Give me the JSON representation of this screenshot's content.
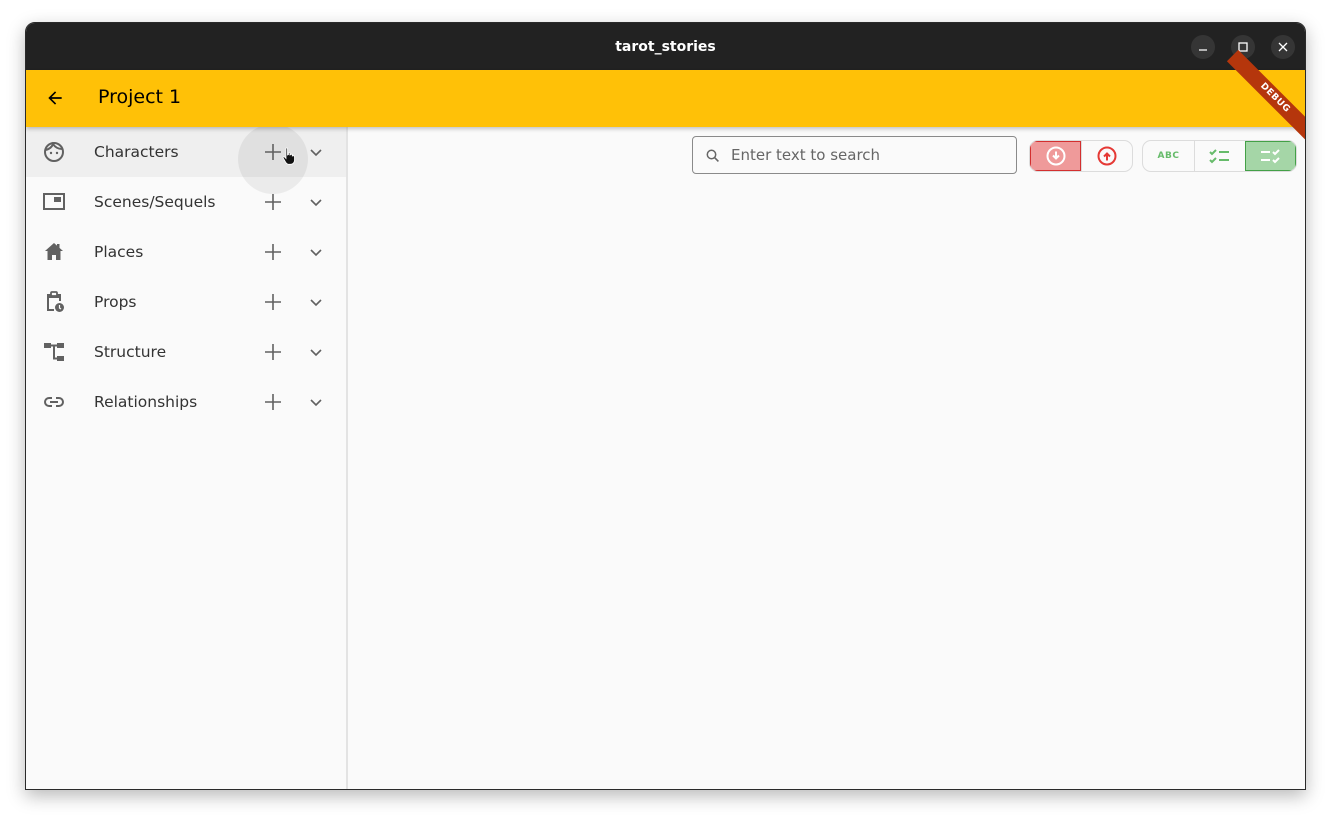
{
  "window": {
    "title": "tarot_stories",
    "controls": [
      "minimize",
      "maximize",
      "close"
    ]
  },
  "appbar": {
    "title": "Project 1",
    "back_icon": "arrow-back-icon",
    "debug_banner": "DEBUG",
    "color": "#ffc107"
  },
  "sidebar": {
    "items": [
      {
        "label": "Characters",
        "icon": "face-icon",
        "hovered": true
      },
      {
        "label": "Scenes/Sequels",
        "icon": "picture-in-picture-icon"
      },
      {
        "label": "Places",
        "icon": "home-icon"
      },
      {
        "label": "Props",
        "icon": "clipboard-clock-icon"
      },
      {
        "label": "Structure",
        "icon": "account-tree-icon"
      },
      {
        "label": "Relationships",
        "icon": "link-icon"
      }
    ]
  },
  "toolbar": {
    "search": {
      "placeholder": "Enter text to search",
      "value": ""
    },
    "sort_order": {
      "options": [
        "descending",
        "ascending"
      ],
      "selected": "descending",
      "accent": "#e53935"
    },
    "view_mode": {
      "options": [
        "abc",
        "checklist",
        "checklist-right"
      ],
      "abc_label": "ABC",
      "selected": "checklist-right",
      "accent": "#66bb6a"
    }
  }
}
